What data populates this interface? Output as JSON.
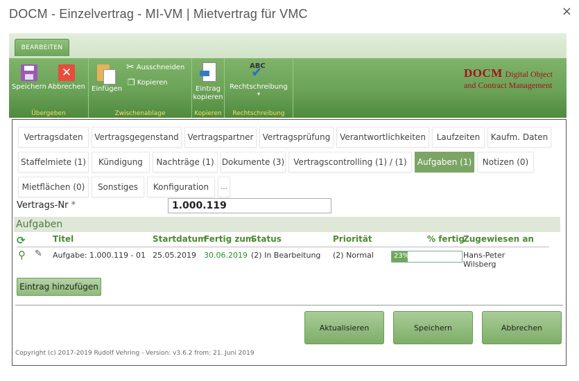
{
  "window": {
    "title": "DOCM - Einzelvertrag - MI-VM | Mietvertrag für VMC",
    "close_symbol": "×"
  },
  "ribbon": {
    "tab_label": "BEARBEITEN",
    "groups": {
      "uebergeben": {
        "label": "Übergeben",
        "save": "Speichern",
        "cancel": "Abbrechen"
      },
      "zwischenablage": {
        "label": "Zwischenablage",
        "paste": "Einfügen",
        "cut": "Ausschneiden",
        "copy": "Kopieren"
      },
      "kopieren": {
        "label": "Kopieren",
        "copy_entry_line1": "Eintrag",
        "copy_entry_line2": "kopieren"
      },
      "rechtschreibung": {
        "label": "Rechtschreibung",
        "spell": "Rechtschreibung",
        "abc": "ABC"
      }
    },
    "logo": {
      "brand": "DOCM",
      "line1": "Digital Object",
      "line2": "and Contract Management"
    }
  },
  "tabs": {
    "row1": [
      "Vertragsdaten",
      "Vertragsgegenstand",
      "Vertragspartner",
      "Vertragsprüfung",
      "Verantwortlichkeiten",
      "Laufzeiten",
      "Kaufm. Daten"
    ],
    "row2": [
      "Staffelmiete (1)",
      "Kündigung",
      "Nachträge (1)",
      "Dokumente (3)",
      "Vertragscontrolling (1) / (1)",
      "Aufgaben (1)",
      "Notizen (0)"
    ],
    "row3": [
      "Mietflächen (0)",
      "Sonstiges",
      "Konfiguration",
      "..."
    ],
    "active": "Aufgaben (1)"
  },
  "contract": {
    "label": "Vertrags-Nr",
    "required_mark": "*",
    "value": "1.000.119"
  },
  "tasks": {
    "section_title": "Aufgaben",
    "columns": {
      "title": "Titel",
      "start": "Startdatum",
      "due": "Fertig zum",
      "status": "Status",
      "priority": "Priorität",
      "percent": "% fertig",
      "assigned": "Zugewiesen an"
    },
    "rows": [
      {
        "title": "Aufgabe: 1.000.119 - 01",
        "start": "25.05.2019",
        "due": "30.06.2019",
        "status": "(2) In Bearbeitung",
        "priority": "(2) Normal",
        "percent_label": "23%",
        "percent": 0.23,
        "assigned_line1": "Hans-Peter",
        "assigned_line2": "Wilsberg"
      }
    ],
    "add_button": "Eintrag hinzufügen"
  },
  "footer": {
    "refresh": "Aktualisieren",
    "save": "Speichern",
    "cancel": "Abbrechen",
    "copyright": "Copyright (c) 2017-2019 Rudolf Vehring - Version: v3.6.2 from: 21. Juni 2019"
  },
  "colors": {
    "accent": "#7ba465",
    "logo": "#a0121a",
    "group_label": "#f5e06a",
    "due_date": "#2e8b2e"
  }
}
